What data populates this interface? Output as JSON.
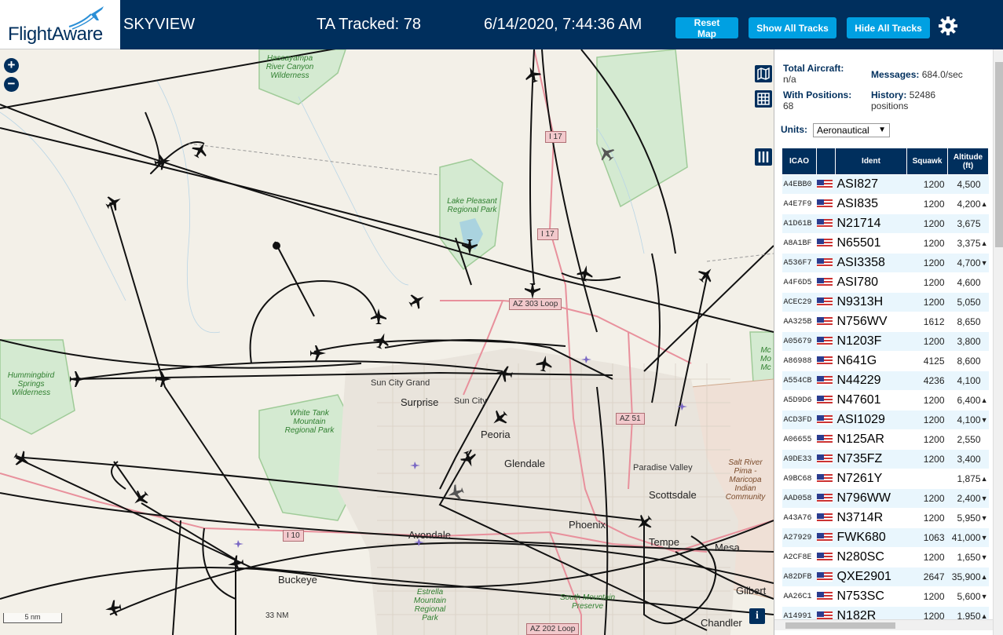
{
  "header": {
    "logo": "FlightAware",
    "app_title": "SKYVIEW",
    "tracked": "TA Tracked: 78",
    "clock": "6/14/2020, 7:44:36 AM",
    "buttons": {
      "reset": "Reset Map",
      "show": "Show All Tracks",
      "hide": "Hide All Tracks"
    },
    "settings_icon": "gear-icon"
  },
  "map": {
    "zoom_in": "+",
    "zoom_out": "−",
    "scale": "5 nm",
    "range_label": "33 NM",
    "info": "i",
    "tools": [
      "map-layers-icon",
      "grid-icon",
      "columns-icon"
    ],
    "labels": {
      "hassayampa": "Hassayampa River Canyon Wilderness",
      "lake_pleasant": "Lake Pleasant Regional Park",
      "hummingbird": "Hummingbird Springs Wilderness",
      "white_tank": "White Tank Mountain Regional Park",
      "sun_city_grand": "Sun City Grand",
      "surprise": "Surprise",
      "sun_city": "Sun City",
      "peoria": "Peoria",
      "glendale": "Glendale",
      "paradise_valley": "Paradise Valley",
      "scottsdale": "Scottsdale",
      "phoenix": "Phoenix",
      "tempe": "Tempe",
      "mesa": "Mesa",
      "avondale": "Avondale",
      "buckeye": "Buckeye",
      "gilbert": "Gilbert",
      "chandler": "Chandler",
      "estrella": "Estrella Mountain Regional Park",
      "south_mountain": "South Mountain Preserve",
      "salt_river": "Salt River Pima - Maricopa Indian Community",
      "mcdowell": "Mc Mo Mc"
    },
    "shields": {
      "i17_north": "I 17",
      "i17": "I 17",
      "az303": "AZ 303 Loop",
      "az51": "AZ 51",
      "i10": "I 10",
      "az202": "AZ 202 Loop"
    }
  },
  "panel": {
    "total_aircraft_label": "Total Aircraft:",
    "total_aircraft_value": "n/a",
    "messages_label": "Messages:",
    "messages_value": "684.0/sec",
    "with_positions_label": "With Positions:",
    "with_positions_value": "68",
    "history_label": "History:",
    "history_value": "52486 positions",
    "units_label": "Units:",
    "units_value": "Aeronautical",
    "columns": [
      "ICAO",
      "",
      "Ident",
      "Squawk",
      "Altitude (ft)"
    ],
    "rows": [
      {
        "icao": "A4EBB0",
        "ident": "ASI827",
        "squawk": "1200",
        "alt": "4,500",
        "trend": ""
      },
      {
        "icao": "A4E7F9",
        "ident": "ASI835",
        "squawk": "1200",
        "alt": "4,200",
        "trend": "▲"
      },
      {
        "icao": "A1D61B",
        "ident": "N21714",
        "squawk": "1200",
        "alt": "3,675",
        "trend": ""
      },
      {
        "icao": "A8A1BF",
        "ident": "N65501",
        "squawk": "1200",
        "alt": "3,375",
        "trend": "▲"
      },
      {
        "icao": "A536F7",
        "ident": "ASI3358",
        "squawk": "1200",
        "alt": "4,700",
        "trend": "▼"
      },
      {
        "icao": "A4F6D5",
        "ident": "ASI780",
        "squawk": "1200",
        "alt": "4,600",
        "trend": ""
      },
      {
        "icao": "ACEC29",
        "ident": "N9313H",
        "squawk": "1200",
        "alt": "5,050",
        "trend": ""
      },
      {
        "icao": "AA325B",
        "ident": "N756WV",
        "squawk": "1612",
        "alt": "8,650",
        "trend": ""
      },
      {
        "icao": "A05679",
        "ident": "N1203F",
        "squawk": "1200",
        "alt": "3,800",
        "trend": ""
      },
      {
        "icao": "A86988",
        "ident": "N641G",
        "squawk": "4125",
        "alt": "8,600",
        "trend": ""
      },
      {
        "icao": "A554CB",
        "ident": "N44229",
        "squawk": "4236",
        "alt": "4,100",
        "trend": ""
      },
      {
        "icao": "A5D9D6",
        "ident": "N47601",
        "squawk": "1200",
        "alt": "6,400",
        "trend": "▲"
      },
      {
        "icao": "ACD3FD",
        "ident": "ASI1029",
        "squawk": "1200",
        "alt": "4,100",
        "trend": "▼"
      },
      {
        "icao": "A06655",
        "ident": "N125AR",
        "squawk": "1200",
        "alt": "2,550",
        "trend": ""
      },
      {
        "icao": "A9DE33",
        "ident": "N735FZ",
        "squawk": "1200",
        "alt": "3,400",
        "trend": ""
      },
      {
        "icao": "A9BC68",
        "ident": "N7261Y",
        "squawk": "",
        "alt": "1,875",
        "trend": "▲"
      },
      {
        "icao": "AAD058",
        "ident": "N796WW",
        "squawk": "1200",
        "alt": "2,400",
        "trend": "▼"
      },
      {
        "icao": "A43A76",
        "ident": "N3714R",
        "squawk": "1200",
        "alt": "5,950",
        "trend": "▼"
      },
      {
        "icao": "A27929",
        "ident": "FWK680",
        "squawk": "1063",
        "alt": "41,000",
        "trend": "▼"
      },
      {
        "icao": "A2CF8E",
        "ident": "N280SC",
        "squawk": "1200",
        "alt": "1,650",
        "trend": "▼"
      },
      {
        "icao": "A82DFB",
        "ident": "QXE2901",
        "squawk": "2647",
        "alt": "35,900",
        "trend": "▲"
      },
      {
        "icao": "AA26C1",
        "ident": "N753SC",
        "squawk": "1200",
        "alt": "5,600",
        "trend": "▼"
      },
      {
        "icao": "A14991",
        "ident": "N182R",
        "squawk": "1200",
        "alt": "1,950",
        "trend": "▲"
      }
    ]
  }
}
